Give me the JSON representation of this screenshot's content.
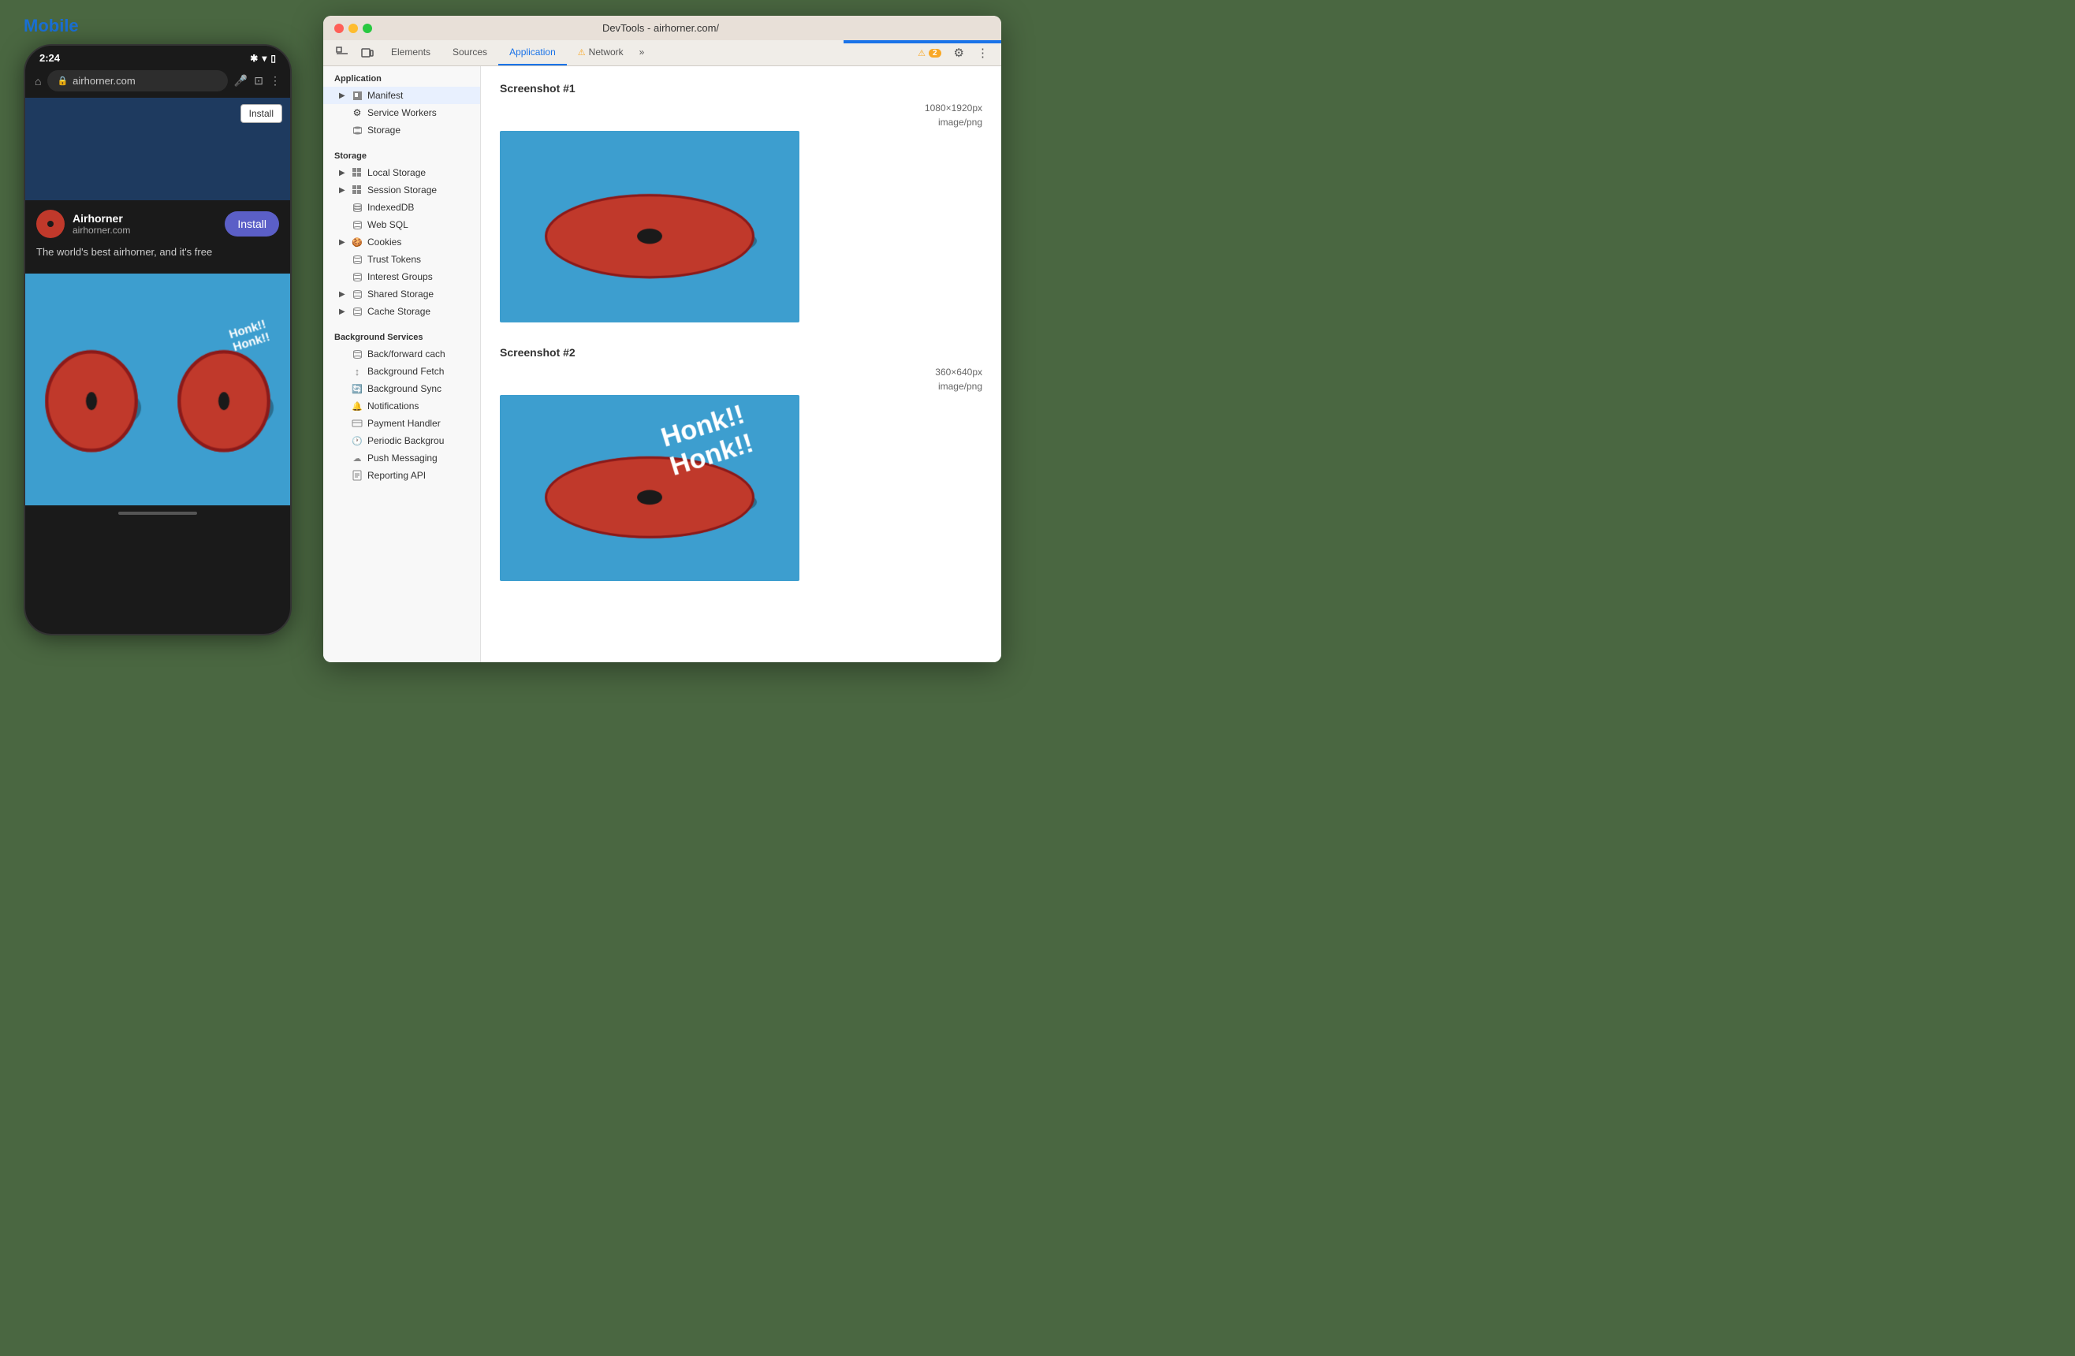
{
  "page": {
    "mobile_label": "Mobile",
    "phone": {
      "time": "2:24",
      "url": "airhorner.com",
      "install_top": "Install",
      "app_name": "Airhorner",
      "app_domain": "airhorner.com",
      "install_btn": "Install",
      "description": "The world's best airhorner, and it's free"
    },
    "devtools": {
      "title": "DevTools - airhorner.com/",
      "tabs": [
        "Elements",
        "Sources",
        "Application",
        "Network"
      ],
      "active_tab": "Application",
      "network_badge": "⚠2",
      "sidebar": {
        "sections": [
          {
            "label": "Application",
            "items": [
              {
                "id": "manifest",
                "label": "Manifest",
                "icon": "📄",
                "arrow": true,
                "active": true
              },
              {
                "id": "service-workers",
                "label": "Service Workers",
                "icon": "⚙"
              },
              {
                "id": "storage",
                "label": "Storage",
                "icon": "🗄"
              }
            ]
          },
          {
            "label": "Storage",
            "items": [
              {
                "id": "local-storage",
                "label": "Local Storage",
                "icon": "⊞",
                "arrow": true
              },
              {
                "id": "session-storage",
                "label": "Session Storage",
                "icon": "⊞",
                "arrow": true
              },
              {
                "id": "indexeddb",
                "label": "IndexedDB",
                "icon": "🗄"
              },
              {
                "id": "web-sql",
                "label": "Web SQL",
                "icon": "🗄"
              },
              {
                "id": "cookies",
                "label": "Cookies",
                "icon": "🍪",
                "arrow": true
              },
              {
                "id": "trust-tokens",
                "label": "Trust Tokens",
                "icon": "🗄"
              },
              {
                "id": "interest-groups",
                "label": "Interest Groups",
                "icon": "🗄"
              },
              {
                "id": "shared-storage",
                "label": "Shared Storage",
                "icon": "🗄",
                "arrow": true
              },
              {
                "id": "cache-storage",
                "label": "Cache Storage",
                "icon": "🗄",
                "arrow": true
              }
            ]
          },
          {
            "label": "Background Services",
            "items": [
              {
                "id": "back-forward",
                "label": "Back/forward cach",
                "icon": "🗄"
              },
              {
                "id": "background-fetch",
                "label": "Background Fetch",
                "icon": "↕"
              },
              {
                "id": "background-sync",
                "label": "Background Sync",
                "icon": "🔄"
              },
              {
                "id": "notifications",
                "label": "Notifications",
                "icon": "🔔"
              },
              {
                "id": "payment-handler",
                "label": "Payment Handler",
                "icon": "💳"
              },
              {
                "id": "periodic-background",
                "label": "Periodic Backgrou",
                "icon": "🕐"
              },
              {
                "id": "push-messaging",
                "label": "Push Messaging",
                "icon": "☁"
              },
              {
                "id": "reporting-api",
                "label": "Reporting API",
                "icon": "📋"
              }
            ]
          }
        ]
      },
      "main": {
        "screenshot1": {
          "title": "Screenshot #1",
          "dimensions": "1080×1920px",
          "type": "image/png"
        },
        "screenshot2": {
          "title": "Screenshot #2",
          "dimensions": "360×640px",
          "type": "image/png"
        }
      }
    }
  }
}
